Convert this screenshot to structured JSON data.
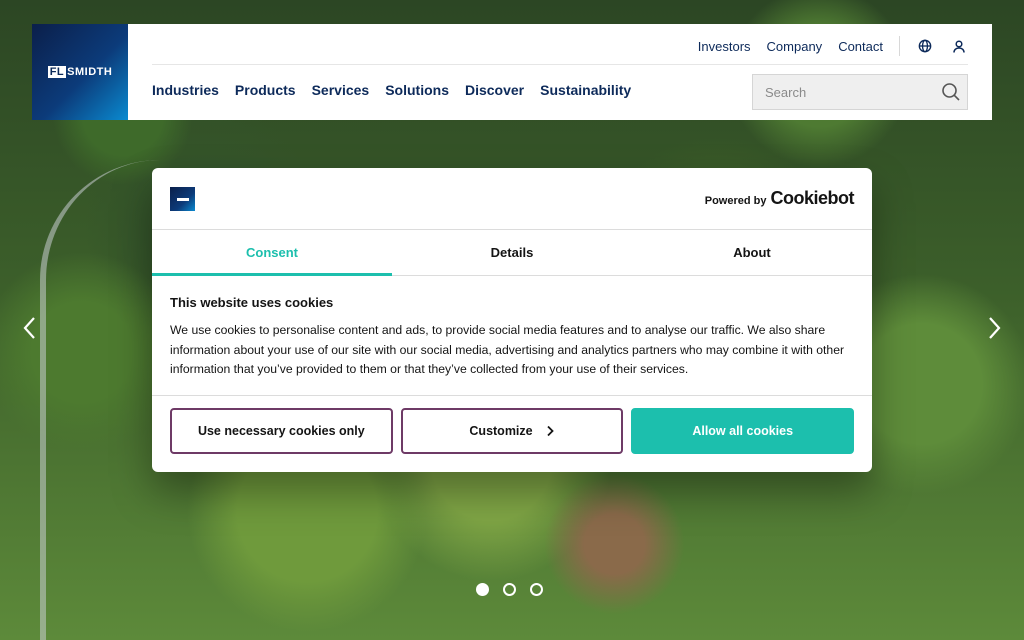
{
  "brand": {
    "logo_fl": "FL",
    "logo_rest": "SMIDTH"
  },
  "utility_nav": {
    "links": [
      "Investors",
      "Company",
      "Contact"
    ],
    "icons": [
      "globe-icon",
      "user-icon"
    ]
  },
  "main_nav": [
    "Industries",
    "Products",
    "Services",
    "Solutions",
    "Discover",
    "Sustainability"
  ],
  "search": {
    "placeholder": "Search",
    "icon": "search-icon"
  },
  "carousel": {
    "slides": 3,
    "active_index": 0,
    "prev_icon": "chevron-left-icon",
    "next_icon": "chevron-right-icon"
  },
  "cookie_dialog": {
    "powered_label": "Powered by",
    "powered_brand": "Cookiebot",
    "tabs": [
      "Consent",
      "Details",
      "About"
    ],
    "active_tab": "Consent",
    "title": "This website uses cookies",
    "body": "We use cookies to personalise content and ads, to provide social media features and to analyse our traffic. We also share information about your use of our site with our social media, advertising and analytics partners who may combine it with other information that you’ve provided to them or that they’ve collected from your use of their services.",
    "buttons": {
      "necessary": "Use necessary cookies only",
      "customize": "Customize",
      "allow_all": "Allow all cookies"
    }
  },
  "colors": {
    "accent": "#1cbfad",
    "navy": "#0d2a5a",
    "button_border": "#6e3a66"
  }
}
